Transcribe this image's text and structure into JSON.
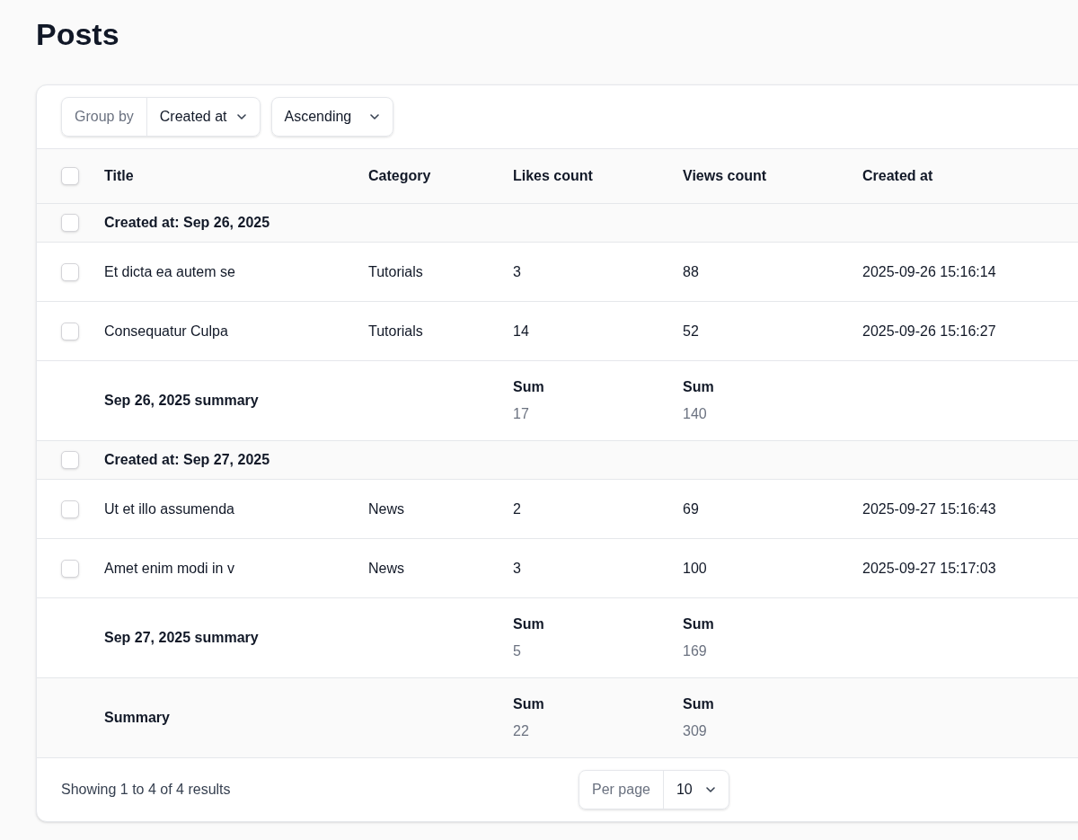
{
  "page": {
    "title": "Posts"
  },
  "toolbar": {
    "group_by": {
      "label": "Group by",
      "value": "Created at"
    },
    "direction": {
      "value": "Ascending"
    }
  },
  "table": {
    "select_all": {
      "checked": false
    },
    "columns": [
      "Title",
      "Category",
      "Likes count",
      "Views count",
      "Created at"
    ],
    "rows": [
      {
        "kind": "group",
        "label": "Created at: Sep 26, 2025",
        "checked": false
      },
      {
        "kind": "record",
        "checked": false,
        "cells": [
          "Et dicta ea autem se",
          "Tutorials",
          "3",
          "88",
          "2025-09-26 15:16:14"
        ]
      },
      {
        "kind": "record",
        "checked": false,
        "cells": [
          "Consequatur Culpa",
          "Tutorials",
          "14",
          "52",
          "2025-09-26 15:16:27"
        ]
      },
      {
        "kind": "summary",
        "label": "Sep 26, 2025 summary",
        "likes": {
          "label": "Sum",
          "value": "17"
        },
        "views": {
          "label": "Sum",
          "value": "140"
        }
      },
      {
        "kind": "group",
        "label": "Created at: Sep 27, 2025",
        "checked": false
      },
      {
        "kind": "record",
        "checked": false,
        "cells": [
          "Ut et illo assumenda",
          "News",
          "2",
          "69",
          "2025-09-27 15:16:43"
        ]
      },
      {
        "kind": "record",
        "checked": false,
        "cells": [
          "Amet enim modi in v",
          "News",
          "3",
          "100",
          "2025-09-27 15:17:03"
        ]
      },
      {
        "kind": "summary",
        "label": "Sep 27, 2025 summary",
        "likes": {
          "label": "Sum",
          "value": "5"
        },
        "views": {
          "label": "Sum",
          "value": "169"
        }
      },
      {
        "kind": "total",
        "label": "Summary",
        "likes": {
          "label": "Sum",
          "value": "22"
        },
        "views": {
          "label": "Sum",
          "value": "309"
        }
      }
    ]
  },
  "footer": {
    "showing": "Showing 1 to 4 of 4 results",
    "per_page": {
      "label": "Per page",
      "value": "10"
    }
  }
}
